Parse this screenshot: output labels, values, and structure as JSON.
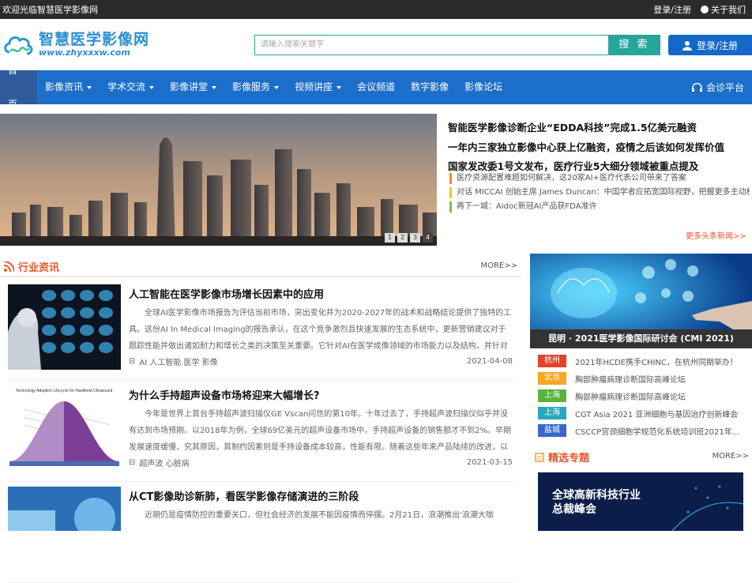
{
  "topbar": {
    "welcome": "欢迎光临智慧医学影像网",
    "login_register": "登录/注册",
    "about": "关于我们"
  },
  "header": {
    "logo_cn": "智慧医学影像网",
    "logo_en": "www.zhyxxxw.com",
    "search_placeholder": "请输入搜索关键字",
    "search_label": "搜 索",
    "login_label": "登录/注册"
  },
  "nav": {
    "items": [
      {
        "label": "首 页"
      },
      {
        "label": "影像资讯"
      },
      {
        "label": "学术交流"
      },
      {
        "label": "影像讲堂"
      },
      {
        "label": "影像服务"
      },
      {
        "label": "视频讲座"
      },
      {
        "label": "会议频道"
      },
      {
        "label": "数字影像"
      },
      {
        "label": "影像论坛"
      }
    ],
    "right": "会诊平台"
  },
  "banner": {
    "pages": [
      "1",
      "2",
      "3",
      "4"
    ],
    "active": 4
  },
  "headlines": [
    "智能医学影像诊断企业“EDDA科技”完成1.5亿美元融资",
    "一年内三家独立影像中心获上亿融资，疫情之后该如何发挥价值",
    "国家发改委1号文发布，医疗行业5大细分领域被重点提及"
  ],
  "subnews": [
    "医疗资源配置难题如何解决，这20家AI+医疗代表公司带来了答案",
    "对话 MICCAI 创始主席 James Duncan：中国学者应拓宽国际视野，把握更多主动权",
    "再下一城：Aidoc新冠AI产品获FDA准许"
  ],
  "more_news": "更多头条新闻>>",
  "section": {
    "title": "行业资讯",
    "more": "MORE>>"
  },
  "articles": [
    {
      "title": "人工智能在医学影像市场增长因素中的应用",
      "desc": "全球AI医学影像市场报告为评估当前市场，突出变化并为2020-2027年的战术和战略结论提供了独特的工具。这份AI In Medical Imaging的报告承认，在这个竞争激烈且快速发展的生态系统中，更新营销建议对于跟踪性能并做出诸如耐力和增长之类的决策至关重要。它针对AI在医学成像领域的市场能力以及结构，并针对改进和",
      "tags": "AI 人工智能 医学 影像",
      "date": "2021-04-08"
    },
    {
      "title": "为什么手持超声设备市场将迎来大幅增长?",
      "desc": "今年是世界上首台手持超声波扫描仪GE Vscan问世的第10年。十年过去了，手持超声波扫描仪似乎并没有达到市场预期。以2018年为例，全球69亿美元的超声设备市场中，手持超声设备的销售额才不到2%。早期发展速度缓慢，究其原因，其制约因素则是手持设备成本较高，性能有限。随着这些年来产品陆续的改进，以及整",
      "tags": "超声波 心脏病",
      "date": "2021-03-15",
      "chart_title": "Technology Adoption Lifecycle for Handheld Ultrasound"
    },
    {
      "title": "从CT影像助诊新肺，看医学影像存储演进的三阶段",
      "desc": "近期仍是疫情防控的重要关口，但社会经济的发展不能因疫情而停摆。2月21日，浪潮推出'浪潮大咖",
      "tags": "",
      "date": ""
    }
  ],
  "sidebar": {
    "caption": "昆明 · 2021医学影像国际研讨会 (CMI 2021)"
  },
  "events": [
    {
      "city": "杭州",
      "text": "2021年HCDE携手CHINC，在杭州同期举办！",
      "color": "#e0452b"
    },
    {
      "city": "北京",
      "text": "胸部肿瘤病理诊断国际高峰论坛",
      "color": "#f5a623"
    },
    {
      "city": "上海",
      "text": "胸部肿瘤病理诊断国际高峰论坛",
      "color": "#5ab33a"
    },
    {
      "city": "上海",
      "text": "CGT Asia 2021 亚洲细胞与基因治疗创新峰会",
      "color": "#2ba8b8"
    },
    {
      "city": "盐城",
      "text": "CSCCP宫颈细胞学规范化系统培训班2021年...",
      "color": "#3867c9"
    }
  ],
  "featured": {
    "title": "精选专题",
    "more": "MORE>>",
    "img_cn_1": "全球高新科技行业",
    "img_cn_2": "总裁峰会"
  }
}
